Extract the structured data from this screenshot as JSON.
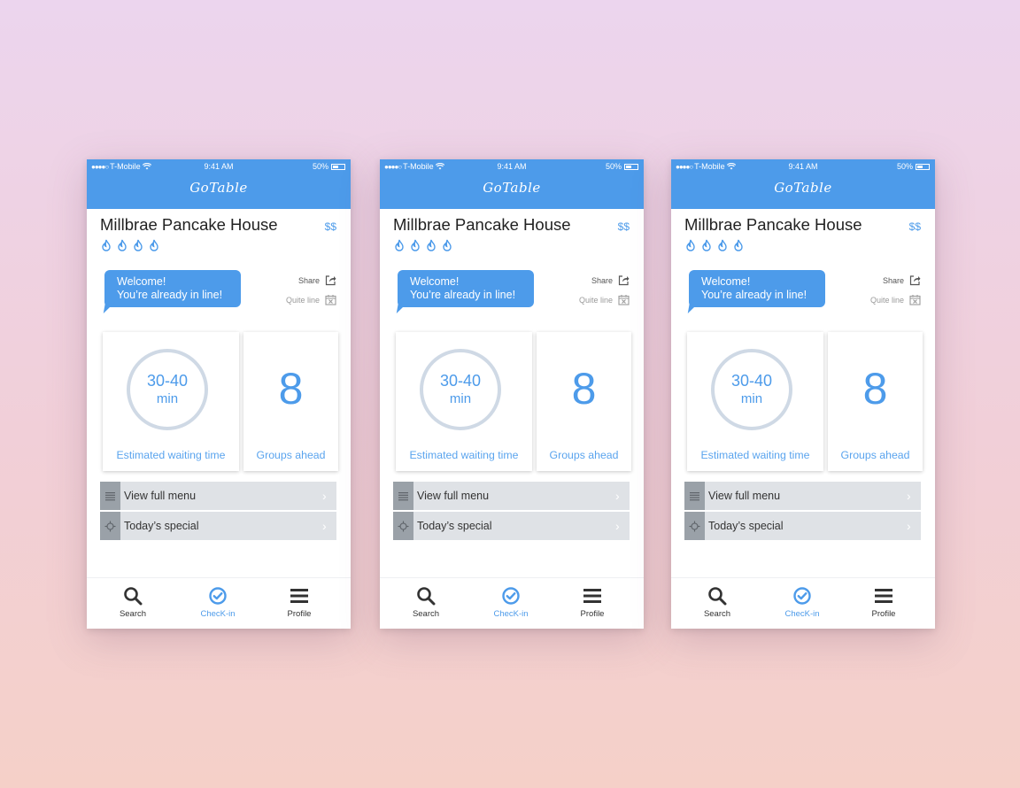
{
  "status_bar": {
    "carrier": "T-Mobile",
    "time": "9:41 AM",
    "battery": "50%"
  },
  "app": {
    "logo": "GoTable"
  },
  "restaurant": {
    "name": "Millbrae Pancake House",
    "price": "$$",
    "rating_icons": 4
  },
  "welcome": {
    "line1": "Welcome!",
    "line2": "You’re already in line!"
  },
  "actions": {
    "share": "Share",
    "quit": "Quite line"
  },
  "wait": {
    "range": "30-40",
    "unit": "min",
    "caption": "Estimated waiting time"
  },
  "groups": {
    "count": "8",
    "caption": "Groups ahead"
  },
  "menu": {
    "full_menu": "View full menu",
    "special": "Today’s special"
  },
  "tabs": {
    "search": "Search",
    "checkin": "ChecK-in",
    "profile": "Profile"
  },
  "colors": {
    "accent": "#4d9bea",
    "ring": "#cfd9e5",
    "menu_bg": "#dfe2e6",
    "menu_icon_bg": "#9aa1a8"
  },
  "icons": [
    "wifi-icon",
    "battery-icon",
    "flame-icon",
    "share-icon",
    "calendar-x-icon",
    "menu-list-icon",
    "special-crosshair-icon",
    "chevron-right-icon",
    "search-icon",
    "check-circle-icon",
    "hamburger-icon"
  ]
}
